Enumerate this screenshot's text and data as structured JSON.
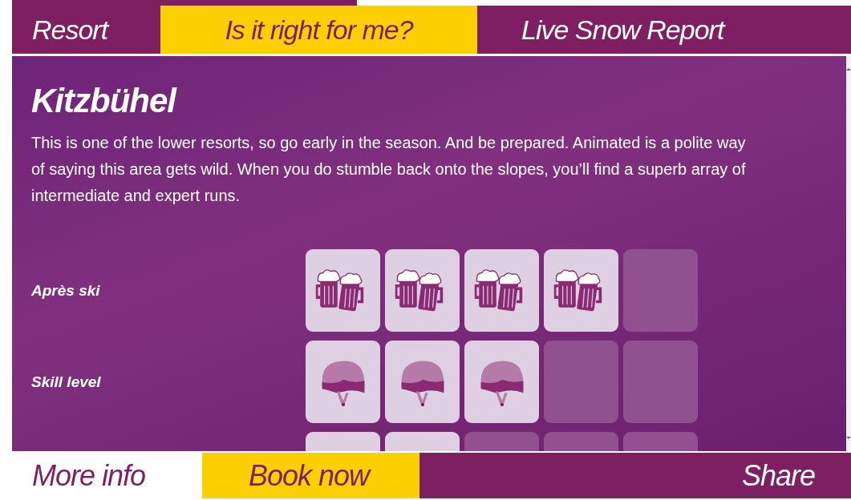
{
  "tabs": [
    {
      "label": "Resort",
      "selected": false
    },
    {
      "label": "Is it right for me?",
      "selected": true
    },
    {
      "label": "Live Snow Report",
      "selected": false
    }
  ],
  "resort": {
    "name": "Kitzbühel",
    "description": "This is one of the lower resorts, so go early in the season. And be prepared. Animated is a polite way of saying this area gets wild. When you do stumble back onto the slopes, you’ll find a superb array of intermediate and expert runs."
  },
  "ratings": [
    {
      "label": "Après ski",
      "kind": "beer",
      "slots": [
        {
          "filled": true
        },
        {
          "filled": true
        },
        {
          "filled": true
        },
        {
          "filled": true
        },
        {
          "filled": false
        }
      ]
    },
    {
      "label": "Skill level",
      "kind": "helmet",
      "slots": [
        {
          "filled": true
        },
        {
          "filled": true
        },
        {
          "filled": true
        },
        {
          "filled": false
        },
        {
          "filled": false
        }
      ]
    },
    {
      "kind": "other",
      "slots": [
        {
          "filled": true
        },
        {
          "filled": true
        },
        {
          "filled": false
        },
        {
          "filled": false
        },
        {
          "filled": false
        }
      ]
    }
  ],
  "actions": [
    {
      "label": "More info",
      "kind": "plain"
    },
    {
      "label": "Book now",
      "kind": "highlight"
    },
    {
      "label": "Share",
      "kind": "dark"
    }
  ]
}
